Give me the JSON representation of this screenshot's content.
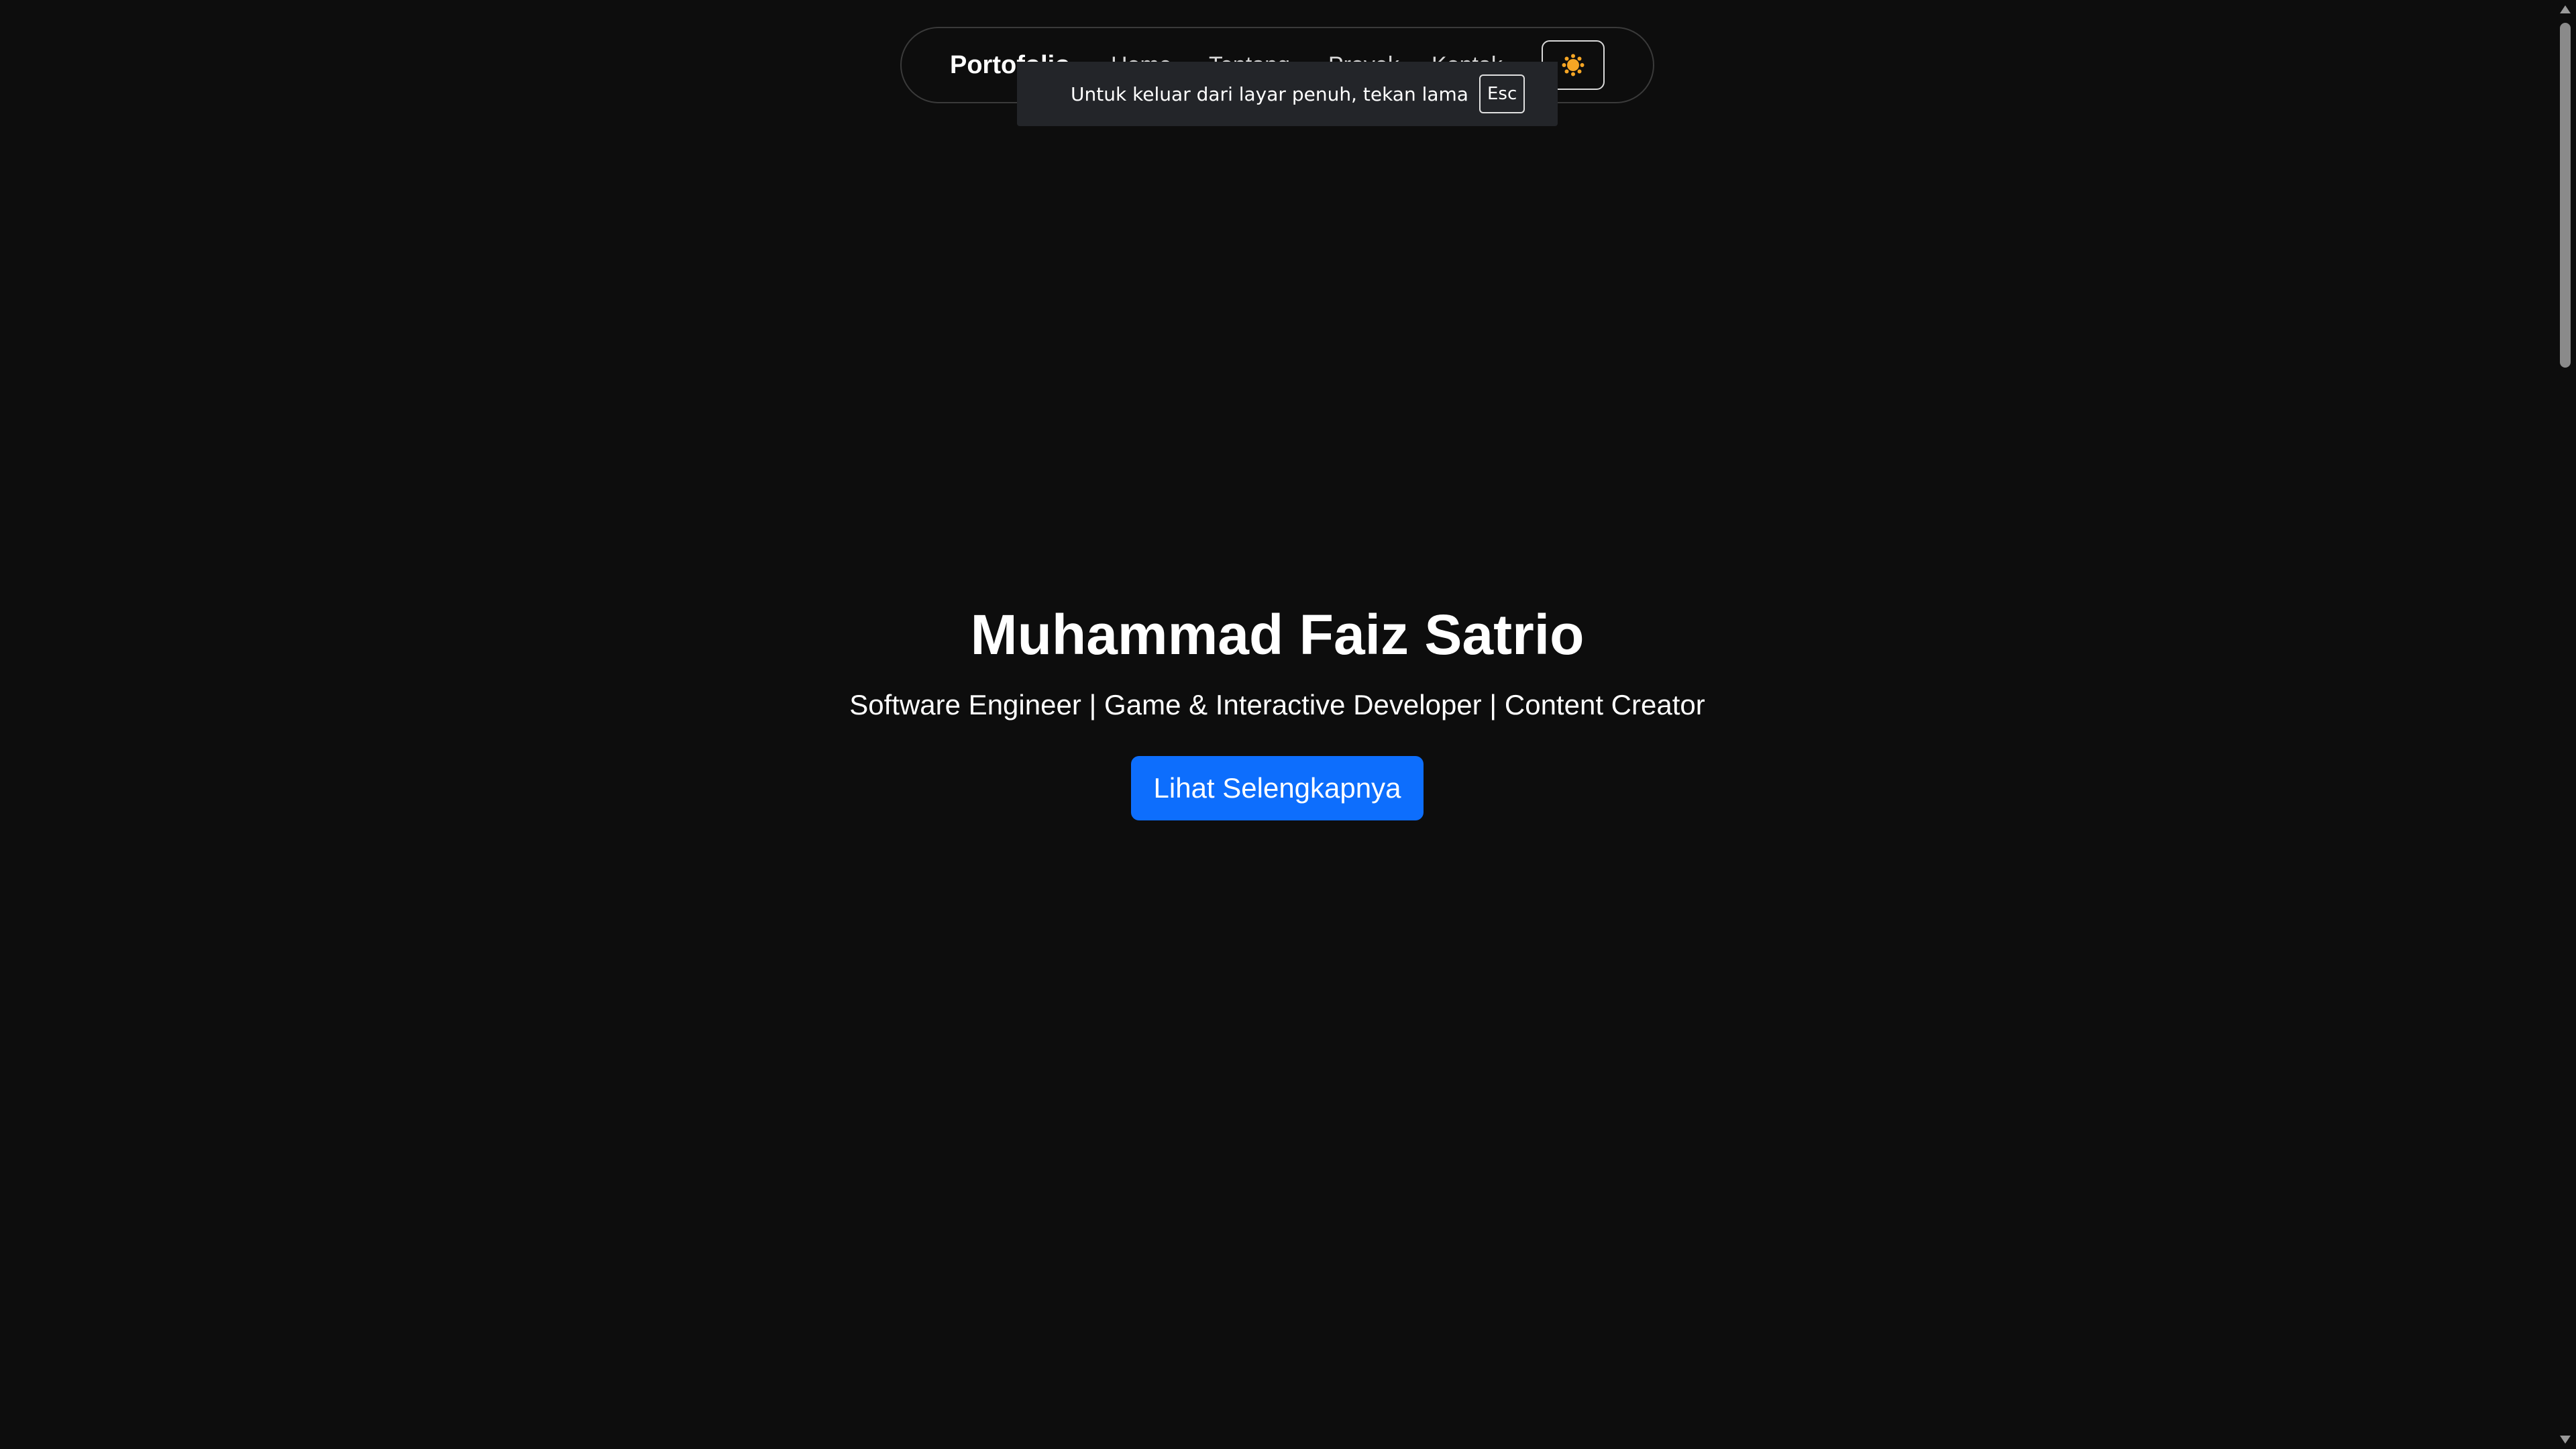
{
  "navbar": {
    "brand": "Portofolio",
    "links": [
      "Home",
      "Tentang",
      "Proyek",
      "Kontak"
    ],
    "theme_toggle_icon": "sun-icon",
    "theme_icon_color": "#f5a524"
  },
  "fullscreen_notice": {
    "text": "Untuk keluar dari layar penuh, tekan lama",
    "key": "Esc"
  },
  "hero": {
    "title": "Muhammad Faiz Satrio",
    "subtitle": "Software Engineer | Game & Interactive Developer | Content Creator",
    "cta_label": "Lihat Selengkapnya",
    "cta_color": "#0d6efd"
  },
  "colors": {
    "background": "#0d0d0d",
    "text": "#ffffff",
    "toast_background": "#232529"
  }
}
